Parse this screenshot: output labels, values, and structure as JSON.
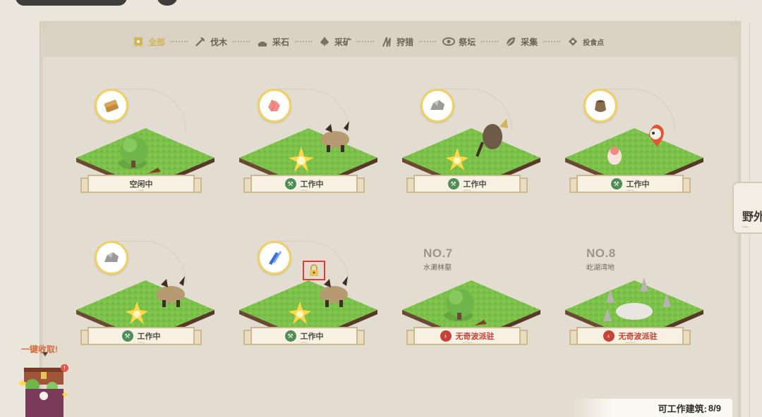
{
  "tabs": [
    {
      "label": "全部",
      "icon": "clover-icon",
      "active": true
    },
    {
      "label": "伐木",
      "icon": "axe-icon",
      "active": false
    },
    {
      "label": "采石",
      "icon": "pickaxe-icon",
      "active": false
    },
    {
      "label": "采矿",
      "icon": "ore-icon",
      "active": false
    },
    {
      "label": "狩猎",
      "icon": "claw-icon",
      "active": false
    },
    {
      "label": "祭坛",
      "icon": "altar-icon",
      "active": false
    },
    {
      "label": "采集",
      "icon": "leaf-icon",
      "active": false
    },
    {
      "label": "投食点",
      "icon": "feed-icon",
      "active": false
    }
  ],
  "buildings": [
    {
      "status": "空闲中",
      "resource": "wood-icon",
      "has_icon": false
    },
    {
      "status": "工作中",
      "resource": "red-ore-icon",
      "has_icon": true
    },
    {
      "status": "工作中",
      "resource": "stone-icon",
      "has_icon": true
    },
    {
      "status": "工作中",
      "resource": "leather-sack-icon",
      "has_icon": true
    },
    {
      "status": "工作中",
      "resource": "stone-icon",
      "has_icon": true
    },
    {
      "status": "工作中",
      "resource": "blue-crystal-icon",
      "has_icon": true
    },
    {
      "number": "NO.7",
      "name": "水濑林壑",
      "status": "无奇波派驻",
      "red": true
    },
    {
      "number": "NO.8",
      "name": "屹湖湾地",
      "status": "无奇波派驻",
      "red": true
    }
  ],
  "side_tab": {
    "label": "野外"
  },
  "collect": {
    "label": "一键收取!",
    "badge": "!"
  },
  "footer": {
    "label": "可工作建筑:",
    "count": "8/9"
  },
  "colors": {
    "accent_gold": "#d3b45a",
    "work_green": "#4f8f56",
    "alert_red": "#c64338",
    "grass": "#7cc24a"
  }
}
